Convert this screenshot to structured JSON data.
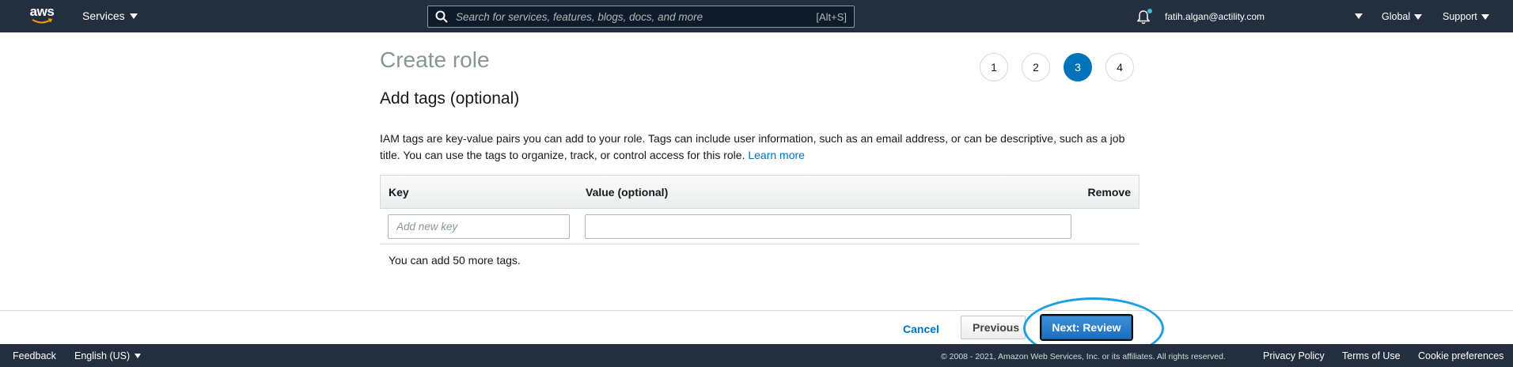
{
  "topnav": {
    "logo_text": "aws",
    "services_label": "Services",
    "search_placeholder": "Search for services, features, blogs, docs, and more",
    "search_shortcut": "[Alt+S]",
    "account": "fatih.algan@actility.com",
    "region": "Global",
    "support": "Support"
  },
  "page": {
    "title": "Create role",
    "steps": [
      "1",
      "2",
      "3",
      "4"
    ],
    "active_step": "3",
    "section_title": "Add tags (optional)",
    "description": "IAM tags are key-value pairs you can add to your role. Tags can include user information, such as an email address, or can be descriptive, such as a job title. You can use the tags to organize, track, or control access for this role.",
    "learn_more": "Learn more"
  },
  "tags_table": {
    "columns": [
      "Key",
      "Value (optional)",
      "Remove"
    ],
    "key_placeholder": "Add new key",
    "value_placeholder": "",
    "note": "You can add 50 more tags."
  },
  "actions": {
    "cancel": "Cancel",
    "previous": "Previous",
    "next": "Next: Review"
  },
  "footer": {
    "feedback": "Feedback",
    "language": "English (US)",
    "copyright": "© 2008 - 2021, Amazon Web Services, Inc. or its affiliates. All rights reserved.",
    "privacy": "Privacy Policy",
    "terms": "Terms of Use",
    "cookies": "Cookie preferences"
  },
  "colors": {
    "nav_bg": "#232f3e",
    "link_blue": "#0073bb",
    "primary_button": "#1a6fc1",
    "highlight_ring": "#1ea0e0"
  }
}
